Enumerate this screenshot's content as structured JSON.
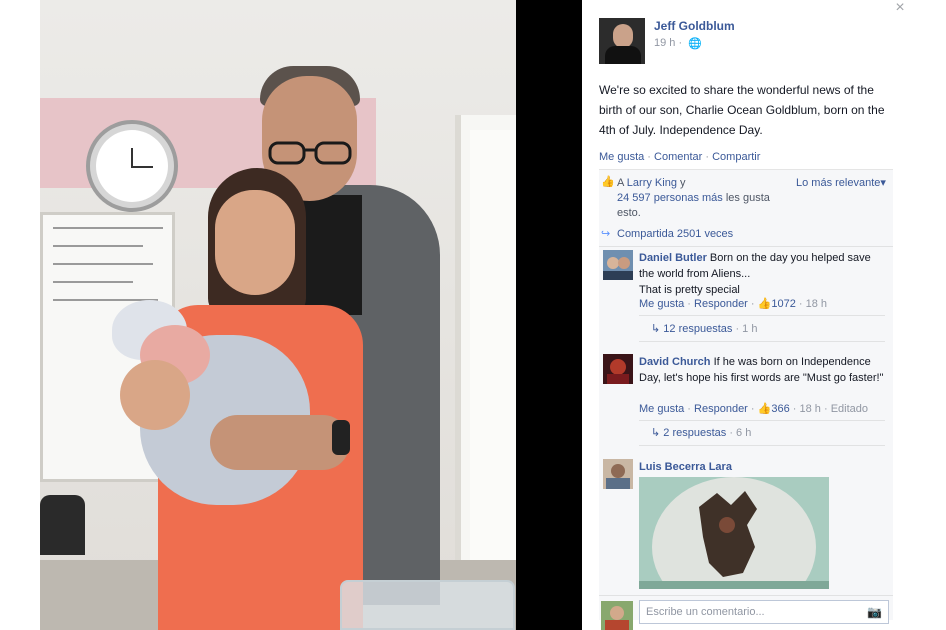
{
  "colors": {
    "facebook_blue": "#3b5998",
    "muted_text": "#9197a3",
    "ufi_background": "#f6f7f9",
    "dress": "#ef6e4f"
  },
  "photo": {
    "description_icon": "photo"
  },
  "post": {
    "author": "Jeff Goldblum",
    "time": "19 h",
    "separator": "·",
    "audience_icon": "globe-icon",
    "text": "We're so excited to share the wonderful news of the birth of our son, Charlie Ocean Goldblum, born on the 4th of July. Independence Day.",
    "close_glyph": "×"
  },
  "actions": {
    "like": "Me gusta",
    "comment": "Comentar",
    "share": "Compartir",
    "dot": " · "
  },
  "reactions": {
    "prefix": "A ",
    "friend": "Larry King",
    "connector": " y",
    "others": "24 597 personas más",
    "suffix": " les gusta esto.",
    "sort": "Lo más relevante",
    "sort_caret": "▾",
    "shares": "Compartida 2501 veces"
  },
  "comments": [
    {
      "author": "Daniel Butler",
      "text": " Born on the day you helped save the world from Aliens... ",
      "text2": "That is pretty special",
      "like": "Me gusta",
      "reply": "Responder",
      "likes": "1072",
      "time": "18 h",
      "replies": "12 respuestas",
      "replies_time": "1 h"
    },
    {
      "author": "David Church",
      "text": " If he was born on Independence Day, let's hope his first words are \"Must go faster!\"",
      "like": "Me gusta",
      "reply": "Responder",
      "likes": "366",
      "time": "18 h",
      "edited": "Editado",
      "replies": "2 respuestas",
      "replies_time": "6 h"
    },
    {
      "author": "Luis Becerra Lara"
    }
  ],
  "composer": {
    "placeholder": "Escribe un comentario..."
  },
  "glyphs": {
    "thumb": "👍",
    "share": "↪",
    "reply_arrow": "↳",
    "camera": "📷",
    "globe": "🌐"
  }
}
